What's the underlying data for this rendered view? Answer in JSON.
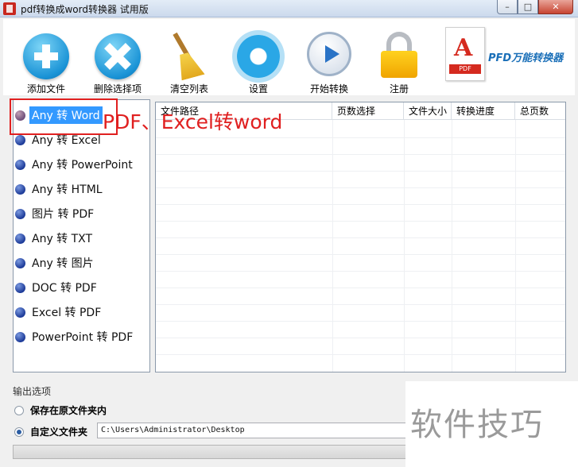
{
  "window": {
    "title": "pdf转换成word转换器 试用版",
    "controls": {
      "minimize": "–",
      "maximize": "□",
      "close": "✕"
    }
  },
  "toolbar": {
    "items": [
      {
        "label": "添加文件",
        "icon": "add-icon"
      },
      {
        "label": "删除选择项",
        "icon": "delete-icon"
      },
      {
        "label": "清空列表",
        "icon": "broom-icon"
      },
      {
        "label": "设置",
        "icon": "gear-icon"
      },
      {
        "label": "开始转换",
        "icon": "play-icon"
      },
      {
        "label": "注册",
        "icon": "lock-icon"
      }
    ],
    "brand": {
      "doc_tag": "PDF",
      "text": "PFD万能转换器"
    }
  },
  "categories": [
    {
      "label": "Any 转 Word",
      "selected": true
    },
    {
      "label": "Any 转 Excel"
    },
    {
      "label": "Any 转 PowerPoint"
    },
    {
      "label": "Any 转 HTML"
    },
    {
      "label": "图片 转 PDF"
    },
    {
      "label": "Any 转 TXT"
    },
    {
      "label": "Any 转 图片"
    },
    {
      "label": "DOC 转 PDF"
    },
    {
      "label": "Excel 转 PDF"
    },
    {
      "label": "PowerPoint 转 PDF"
    }
  ],
  "annotation": "PDF、Excel转word",
  "table": {
    "columns": [
      "文件路径",
      "页数选择",
      "文件大小",
      "转换进度",
      "总页数"
    ],
    "rows": []
  },
  "output": {
    "title": "输出选项",
    "option_original": "保存在原文件夹内",
    "option_custom": "自定义文件夹",
    "custom_selected": true,
    "path": "C:\\Users\\Administrator\\Desktop"
  },
  "progress": 0,
  "watermark": "软件技巧",
  "colors": {
    "accent": "#3399ff",
    "annotation": "#e02020",
    "icon_blue": "#1a93d6"
  }
}
